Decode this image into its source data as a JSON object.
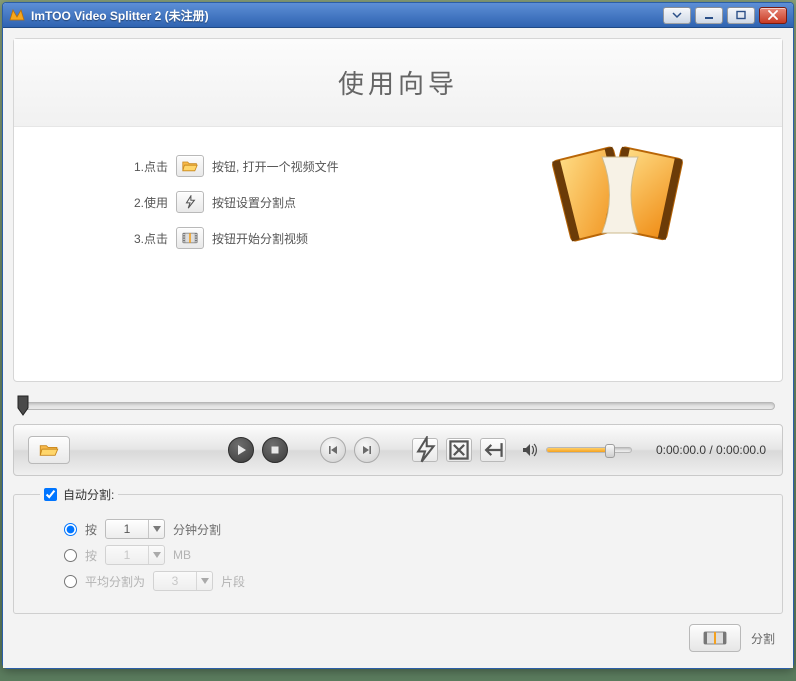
{
  "titlebar": {
    "app_title": "ImTOO Video Splitter 2 (未注册)"
  },
  "wizard": {
    "heading": "使用向导",
    "step1_pre": "1.点击",
    "step1_post": "按钮, 打开一个视频文件",
    "step2_pre": "2.使用",
    "step2_post": "按钮设置分割点",
    "step3_pre": "3.点击",
    "step3_post": "按钮开始分割视频"
  },
  "player": {
    "time_display": "0:00:00.0 / 0:00:00.0"
  },
  "autosplit": {
    "legend_label": "自动分割:",
    "opt1_pre": "按",
    "opt1_value": "1",
    "opt1_post": "分钟分割",
    "opt2_pre": "按",
    "opt2_value": "1",
    "opt2_post": "MB",
    "opt3_pre": "平均分割为",
    "opt3_value": "3",
    "opt3_post": "片段",
    "checked": true,
    "selected": 0
  },
  "actions": {
    "split_label": "分割"
  }
}
